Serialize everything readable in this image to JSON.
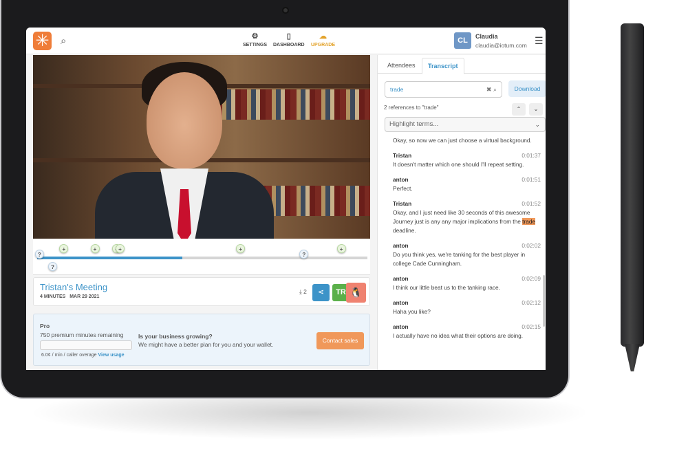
{
  "header": {
    "logo": "iotum-logo",
    "nav": [
      {
        "label": "SETTINGS",
        "icon": "gear-icon"
      },
      {
        "label": "DASHBOARD",
        "icon": "calendar-icon"
      },
      {
        "label": "UPGRADE",
        "icon": "cloud-upload-icon",
        "color": "#e3a32b"
      }
    ],
    "user": {
      "initials": "CL",
      "name": "Claudia",
      "email": "claudia@iotum.com"
    }
  },
  "timeline": {
    "progress_percent": 44,
    "markers": [
      "?",
      "?",
      "+",
      "+",
      "+",
      "+",
      "+",
      "?",
      "+"
    ]
  },
  "meeting": {
    "title": "Tristan's Meeting",
    "duration": "4 MINUTES",
    "date": "MAR 29 2021",
    "downloads": "2",
    "attendee_initials": "TR"
  },
  "plan": {
    "name": "Pro",
    "remaining": "750 premium minutes remaining",
    "overage": "6.0¢ / min / caller overage",
    "view_usage": "View usage",
    "question": "Is your business growing?",
    "pitch": "We might have a better plan for you and your wallet.",
    "cta": "Contact sales"
  },
  "sidebar": {
    "tabs": [
      "Attendees",
      "Transcript"
    ],
    "active_tab": "Transcript",
    "search_value": "trade",
    "download": "Download",
    "references": "2 references to \"trade\"",
    "highlight_placeholder": "Highlight terms...",
    "entries": [
      {
        "speaker": "",
        "time": "",
        "text": "Okay, so now we can just choose a virtual background."
      },
      {
        "speaker": "Tristan",
        "time": "0:01:37",
        "text": "It doesn't matter which one should I'll repeat setting."
      },
      {
        "speaker": "anton",
        "time": "0:01:51",
        "text": "Perfect."
      },
      {
        "speaker": "Tristan",
        "time": "0:01:52",
        "text_before": "Okay, and I just need like 30 seconds of this awesome Journey just is any any major implications from the ",
        "highlight": "trade",
        "text_after": " deadline."
      },
      {
        "speaker": "anton",
        "time": "0:02:02",
        "text": "Do you think yes, we're tanking for the best player in college Cade Cunningham."
      },
      {
        "speaker": "anton",
        "time": "0:02:09",
        "text": "I think our little beat us to the tanking race."
      },
      {
        "speaker": "anton",
        "time": "0:02:12",
        "text": "Haha you like?"
      },
      {
        "speaker": "anton",
        "time": "0:02:15",
        "text": "I actually have no idea what their options are doing."
      }
    ]
  },
  "colors": {
    "accent": "#3c93c8",
    "logo": "#ef7d39",
    "cta": "#f0985a",
    "highlight": "#f0985a"
  }
}
